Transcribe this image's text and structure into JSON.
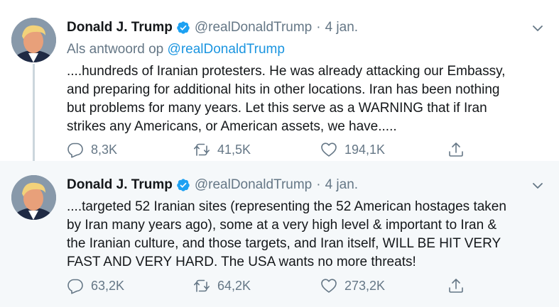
{
  "tweets": [
    {
      "author_name": "Donald J. Trump",
      "handle": "@realDonaldTrump",
      "separator": "·",
      "date": "4 jan.",
      "reply_prefix": "Als antwoord op",
      "reply_handle": "@realDonaldTrump",
      "text": "....hundreds of Iranian protesters. He was already attacking our Embassy,\nand preparing for additional hits in other locations. Iran has been nothing\nbut problems for many years. Let this serve as a WARNING that if Iran\nstrikes any Americans, or American assets, we have.....",
      "replies": "8,3K",
      "retweets": "41,5K",
      "likes": "194,1K"
    },
    {
      "author_name": "Donald J. Trump",
      "handle": "@realDonaldTrump",
      "separator": "·",
      "date": "4 jan.",
      "text": "....targeted 52 Iranian sites (representing the 52 American hostages taken\nby Iran many years ago), some at a very high level & important to Iran &\nthe Iranian culture, and those targets, and Iran itself, WILL BE HIT VERY\nFAST AND VERY HARD. The USA wants no more threats!",
      "replies": "63,2K",
      "retweets": "64,2K",
      "likes": "273,2K"
    }
  ],
  "colors": {
    "verified_badge": "#1da1f2",
    "link": "#1b95e0",
    "secondary_text": "#657786",
    "second_tweet_background": "#f5f8fa",
    "thread_line": "#ccd6dd"
  },
  "icons": [
    "verified-badge-icon",
    "chevron-down-icon",
    "reply-icon",
    "retweet-icon",
    "like-icon",
    "share-icon"
  ]
}
